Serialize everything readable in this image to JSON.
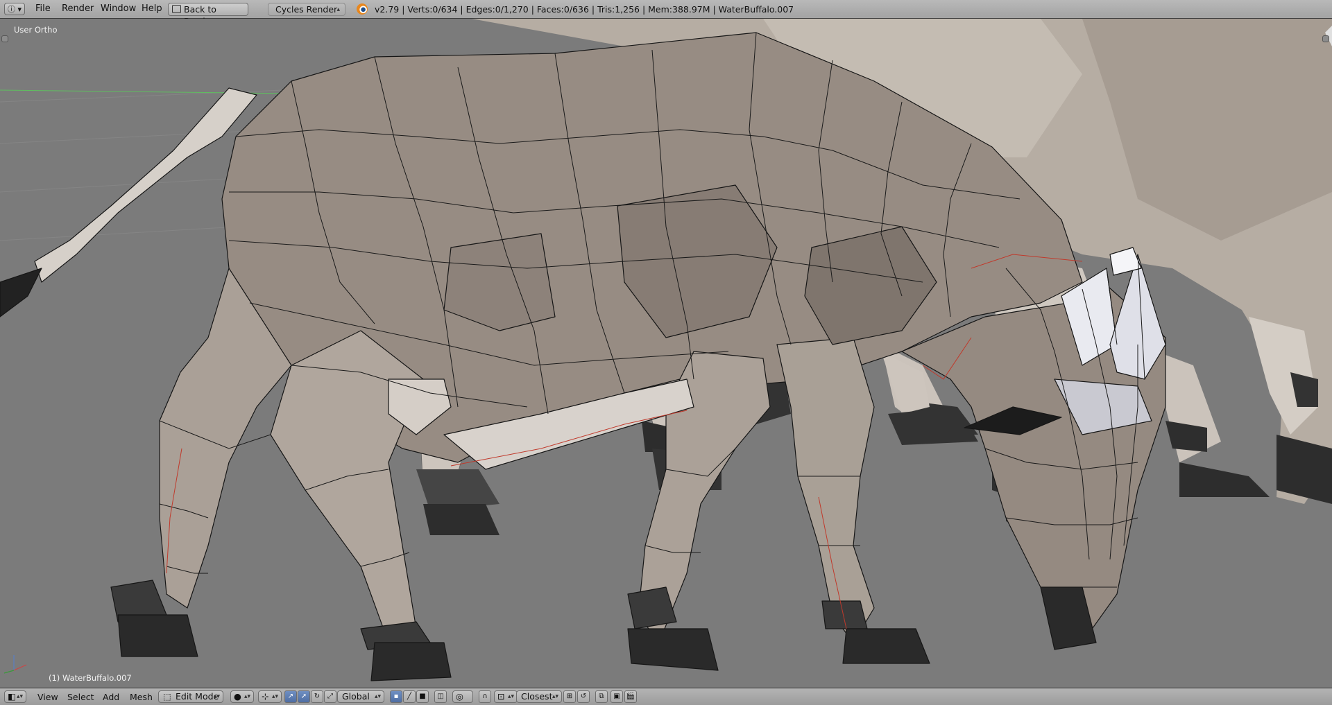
{
  "header": {
    "menus": [
      "File",
      "Render",
      "Window",
      "Help"
    ],
    "back_button": "Back to Previous",
    "render_engine": "Cycles Render",
    "stats": "v2.79 | Verts:0/634 | Edges:0/1,270 | Faces:0/636 | Tris:1,256 | Mem:388.97M | WaterBuffalo.007"
  },
  "viewport": {
    "view_label": "User Ortho",
    "object_label": "(1) WaterBuffalo.007",
    "background": "#7b7b7b",
    "mesh_fill": "#9c9189",
    "wire_color": "#151515",
    "seam_color": "#c0392b"
  },
  "footer": {
    "menus": [
      "View",
      "Select",
      "Add",
      "Mesh"
    ],
    "mode": "Edit Mode",
    "orientation": "Global",
    "snap_target": "Closest"
  }
}
